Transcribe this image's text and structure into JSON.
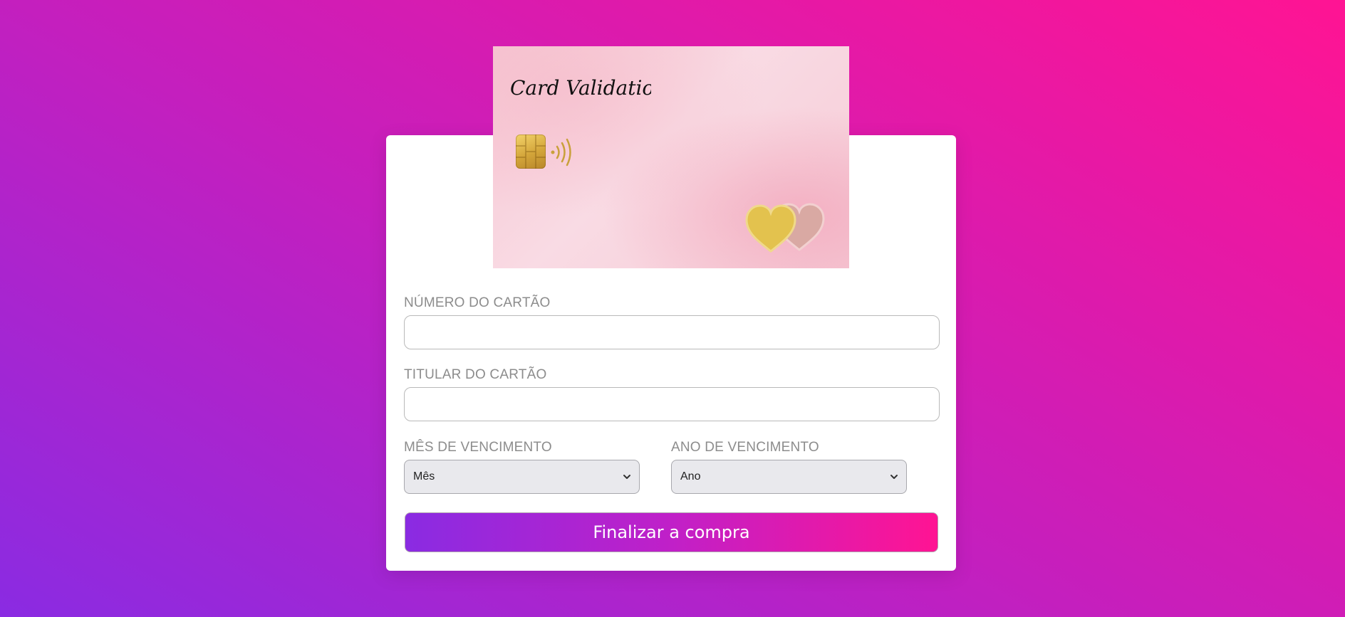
{
  "card": {
    "brand_text": "Card Validation",
    "chip_icon": "card-chip-icon",
    "contactless_icon": "contactless-icon",
    "decoration_icon": "hearts-icon",
    "colors": {
      "card_pink": "#f9dbe4",
      "gold": "#d3a53a"
    }
  },
  "form": {
    "card_number_label": "NÚMERO DO CARTÃO",
    "card_number_value": "",
    "card_holder_label": "TITULAR DO CARTÃO",
    "card_holder_value": "",
    "exp_month_label": "MÊS DE VENCIMENTO",
    "exp_month_selected": "Mês",
    "exp_year_label": "ANO DE VENCIMENTO",
    "exp_year_selected": "Ano",
    "submit_label": "Finalizar a compra"
  },
  "theme": {
    "gradient_start": "#8a2be2",
    "gradient_end": "#ff1493",
    "label_color": "#8c8c8c"
  }
}
